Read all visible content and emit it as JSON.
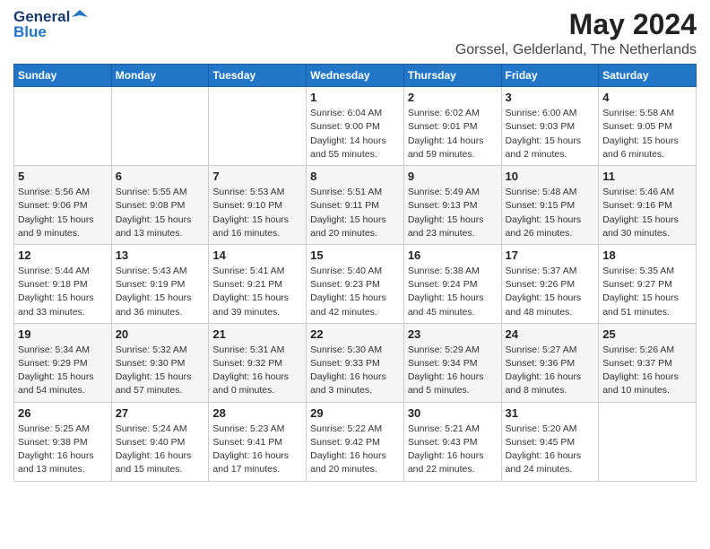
{
  "header": {
    "logo_general": "General",
    "logo_blue": "Blue",
    "month_title": "May 2024",
    "subtitle": "Gorssel, Gelderland, The Netherlands"
  },
  "days_of_week": [
    "Sunday",
    "Monday",
    "Tuesday",
    "Wednesday",
    "Thursday",
    "Friday",
    "Saturday"
  ],
  "weeks": [
    [
      {
        "day": "",
        "info": ""
      },
      {
        "day": "",
        "info": ""
      },
      {
        "day": "",
        "info": ""
      },
      {
        "day": "1",
        "info": "Sunrise: 6:04 AM\nSunset: 9:00 PM\nDaylight: 14 hours\nand 55 minutes."
      },
      {
        "day": "2",
        "info": "Sunrise: 6:02 AM\nSunset: 9:01 PM\nDaylight: 14 hours\nand 59 minutes."
      },
      {
        "day": "3",
        "info": "Sunrise: 6:00 AM\nSunset: 9:03 PM\nDaylight: 15 hours\nand 2 minutes."
      },
      {
        "day": "4",
        "info": "Sunrise: 5:58 AM\nSunset: 9:05 PM\nDaylight: 15 hours\nand 6 minutes."
      }
    ],
    [
      {
        "day": "5",
        "info": "Sunrise: 5:56 AM\nSunset: 9:06 PM\nDaylight: 15 hours\nand 9 minutes."
      },
      {
        "day": "6",
        "info": "Sunrise: 5:55 AM\nSunset: 9:08 PM\nDaylight: 15 hours\nand 13 minutes."
      },
      {
        "day": "7",
        "info": "Sunrise: 5:53 AM\nSunset: 9:10 PM\nDaylight: 15 hours\nand 16 minutes."
      },
      {
        "day": "8",
        "info": "Sunrise: 5:51 AM\nSunset: 9:11 PM\nDaylight: 15 hours\nand 20 minutes."
      },
      {
        "day": "9",
        "info": "Sunrise: 5:49 AM\nSunset: 9:13 PM\nDaylight: 15 hours\nand 23 minutes."
      },
      {
        "day": "10",
        "info": "Sunrise: 5:48 AM\nSunset: 9:15 PM\nDaylight: 15 hours\nand 26 minutes."
      },
      {
        "day": "11",
        "info": "Sunrise: 5:46 AM\nSunset: 9:16 PM\nDaylight: 15 hours\nand 30 minutes."
      }
    ],
    [
      {
        "day": "12",
        "info": "Sunrise: 5:44 AM\nSunset: 9:18 PM\nDaylight: 15 hours\nand 33 minutes."
      },
      {
        "day": "13",
        "info": "Sunrise: 5:43 AM\nSunset: 9:19 PM\nDaylight: 15 hours\nand 36 minutes."
      },
      {
        "day": "14",
        "info": "Sunrise: 5:41 AM\nSunset: 9:21 PM\nDaylight: 15 hours\nand 39 minutes."
      },
      {
        "day": "15",
        "info": "Sunrise: 5:40 AM\nSunset: 9:23 PM\nDaylight: 15 hours\nand 42 minutes."
      },
      {
        "day": "16",
        "info": "Sunrise: 5:38 AM\nSunset: 9:24 PM\nDaylight: 15 hours\nand 45 minutes."
      },
      {
        "day": "17",
        "info": "Sunrise: 5:37 AM\nSunset: 9:26 PM\nDaylight: 15 hours\nand 48 minutes."
      },
      {
        "day": "18",
        "info": "Sunrise: 5:35 AM\nSunset: 9:27 PM\nDaylight: 15 hours\nand 51 minutes."
      }
    ],
    [
      {
        "day": "19",
        "info": "Sunrise: 5:34 AM\nSunset: 9:29 PM\nDaylight: 15 hours\nand 54 minutes."
      },
      {
        "day": "20",
        "info": "Sunrise: 5:32 AM\nSunset: 9:30 PM\nDaylight: 15 hours\nand 57 minutes."
      },
      {
        "day": "21",
        "info": "Sunrise: 5:31 AM\nSunset: 9:32 PM\nDaylight: 16 hours\nand 0 minutes."
      },
      {
        "day": "22",
        "info": "Sunrise: 5:30 AM\nSunset: 9:33 PM\nDaylight: 16 hours\nand 3 minutes."
      },
      {
        "day": "23",
        "info": "Sunrise: 5:29 AM\nSunset: 9:34 PM\nDaylight: 16 hours\nand 5 minutes."
      },
      {
        "day": "24",
        "info": "Sunrise: 5:27 AM\nSunset: 9:36 PM\nDaylight: 16 hours\nand 8 minutes."
      },
      {
        "day": "25",
        "info": "Sunrise: 5:26 AM\nSunset: 9:37 PM\nDaylight: 16 hours\nand 10 minutes."
      }
    ],
    [
      {
        "day": "26",
        "info": "Sunrise: 5:25 AM\nSunset: 9:38 PM\nDaylight: 16 hours\nand 13 minutes."
      },
      {
        "day": "27",
        "info": "Sunrise: 5:24 AM\nSunset: 9:40 PM\nDaylight: 16 hours\nand 15 minutes."
      },
      {
        "day": "28",
        "info": "Sunrise: 5:23 AM\nSunset: 9:41 PM\nDaylight: 16 hours\nand 17 minutes."
      },
      {
        "day": "29",
        "info": "Sunrise: 5:22 AM\nSunset: 9:42 PM\nDaylight: 16 hours\nand 20 minutes."
      },
      {
        "day": "30",
        "info": "Sunrise: 5:21 AM\nSunset: 9:43 PM\nDaylight: 16 hours\nand 22 minutes."
      },
      {
        "day": "31",
        "info": "Sunrise: 5:20 AM\nSunset: 9:45 PM\nDaylight: 16 hours\nand 24 minutes."
      },
      {
        "day": "",
        "info": ""
      }
    ]
  ]
}
